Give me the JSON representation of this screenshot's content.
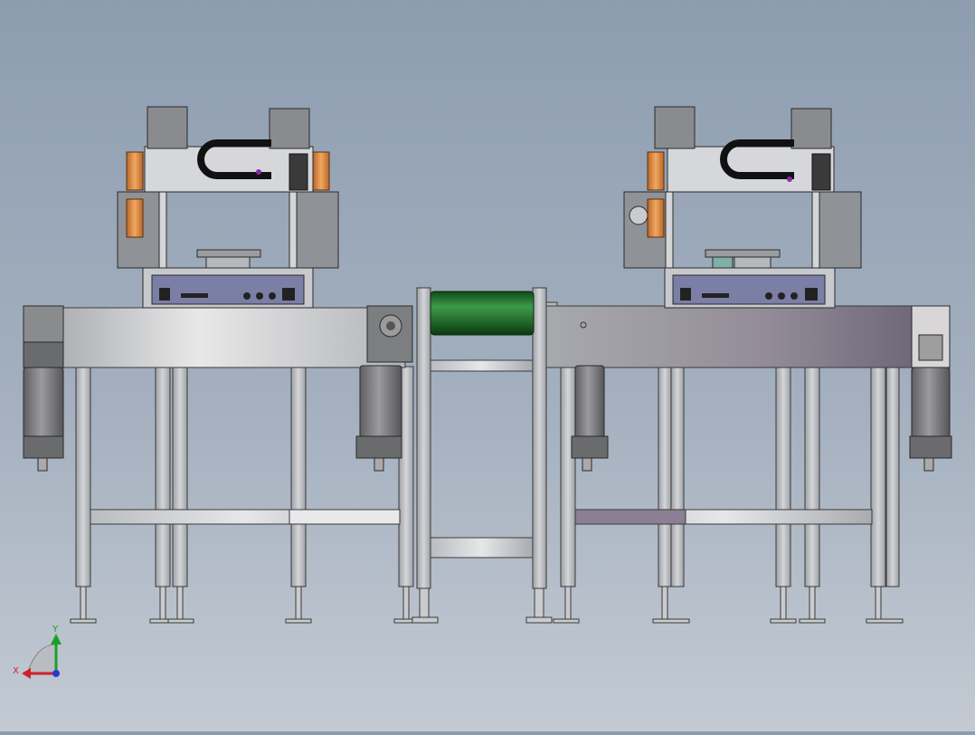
{
  "view": {
    "background_top": "#8d9db0",
    "background_bottom": "#c3cad3",
    "triad": {
      "x_label": "X",
      "y_label": "Y",
      "x_color": "#d0202a",
      "y_color": "#1aa02a",
      "z_color": "#2a3ad0"
    }
  },
  "colors": {
    "steel": "#c9cdd2",
    "roller": "#1f6b2a",
    "control_panel": "#7b7fa6",
    "bellows": "#d88a3a",
    "motor": "#7a7a7a"
  }
}
